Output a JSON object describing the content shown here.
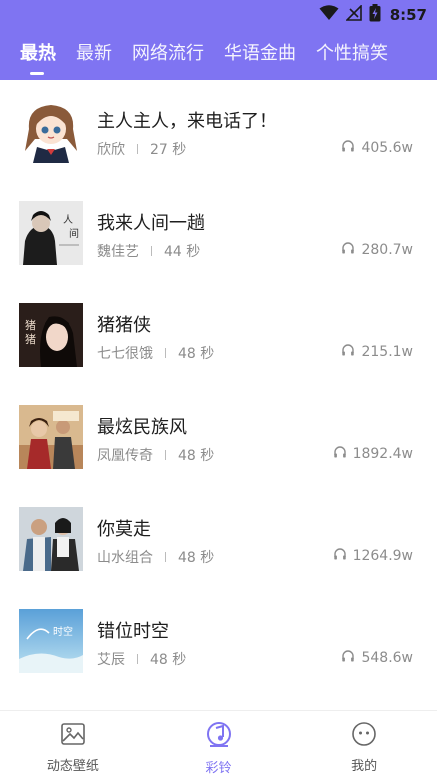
{
  "status_bar": {
    "time": "8:57",
    "icons": [
      "wifi-icon",
      "signal-icon",
      "battery-icon"
    ]
  },
  "tabs": [
    {
      "label": "最热",
      "active": true
    },
    {
      "label": "最新",
      "active": false
    },
    {
      "label": "网络流行",
      "active": false
    },
    {
      "label": "华语金曲",
      "active": false
    },
    {
      "label": "个性搞笑",
      "active": false
    }
  ],
  "songs": [
    {
      "title": "主人主人，来电话了！",
      "artist": "欣欣",
      "duration": "27 秒",
      "plays": "405.6w"
    },
    {
      "title": "我来人间一趟",
      "artist": "魏佳艺",
      "duration": "44 秒",
      "plays": "280.7w"
    },
    {
      "title": "猪猪侠",
      "artist": "七七很饿",
      "duration": "48 秒",
      "plays": "215.1w"
    },
    {
      "title": "最炫民族风",
      "artist": "凤凰传奇",
      "duration": "48 秒",
      "plays": "1892.4w"
    },
    {
      "title": "你莫走",
      "artist": "山水组合",
      "duration": "48 秒",
      "plays": "1264.9w"
    },
    {
      "title": "错位时空",
      "artist": "艾辰",
      "duration": "48 秒",
      "plays": "548.6w"
    }
  ],
  "bottom_nav": [
    {
      "label": "动态壁纸",
      "icon": "image-icon",
      "active": false
    },
    {
      "label": "彩铃",
      "icon": "ringtone-icon",
      "active": true
    },
    {
      "label": "我的",
      "icon": "face-icon",
      "active": false
    }
  ],
  "colors": {
    "accent": "#7f74f2",
    "text": "#1e1e1e",
    "subtext": "#8c8c8c"
  }
}
